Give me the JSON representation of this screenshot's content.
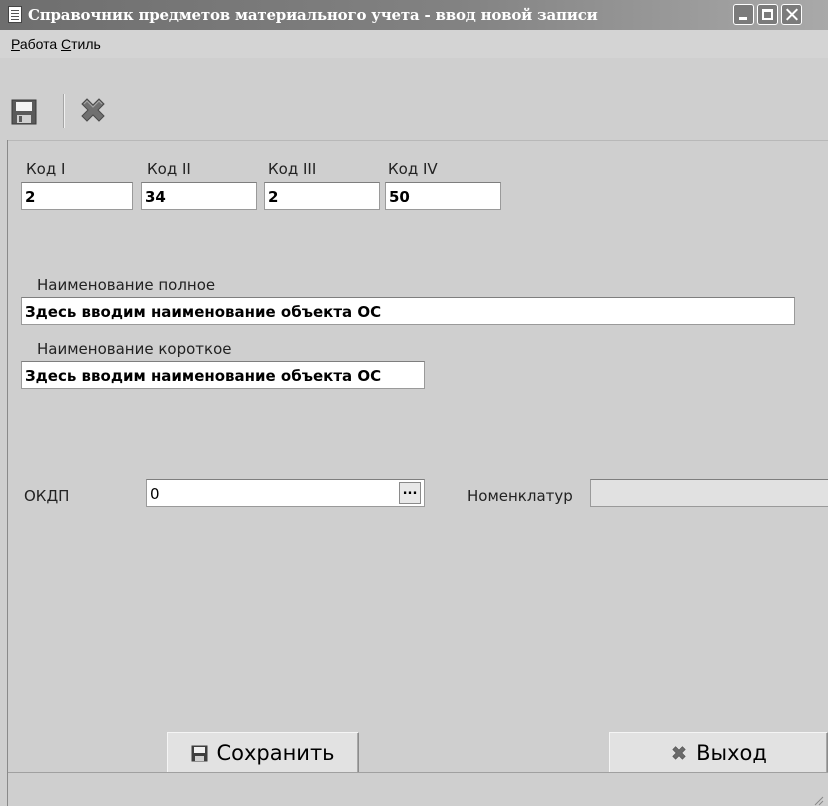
{
  "window": {
    "title": "Справочник предметов материального учета - ввод новой записи"
  },
  "menu": {
    "items": [
      {
        "accel": "Р",
        "rest": "абота"
      },
      {
        "accel": "С",
        "rest": "тиль"
      }
    ]
  },
  "toolbar": {
    "buttons": [
      {
        "icon": "save-icon"
      },
      {
        "icon": "delete-x-icon"
      }
    ]
  },
  "codes": [
    {
      "label": "Код I",
      "value": "2"
    },
    {
      "label": "Код II",
      "value": "34"
    },
    {
      "label": "Код III",
      "value": "2"
    },
    {
      "label": "Код IV",
      "value": "50"
    }
  ],
  "name_full": {
    "label": "Наименование полное",
    "value": "Здесь вводим наименование объекта ОС"
  },
  "name_short": {
    "label": "Наименование короткое",
    "value": "Здесь вводим наименование объекта ОС"
  },
  "okdp": {
    "label": "ОКДП",
    "value": "0",
    "button": "..."
  },
  "nomenclature": {
    "label": "Номенклатур",
    "value": ""
  },
  "buttons": {
    "save_label": "Сохранить",
    "exit_label": "Выход"
  },
  "colors": {
    "titlebar": "#7a7a7a",
    "window_bg": "#cfcfcf",
    "field_bg": "#ffffff"
  }
}
